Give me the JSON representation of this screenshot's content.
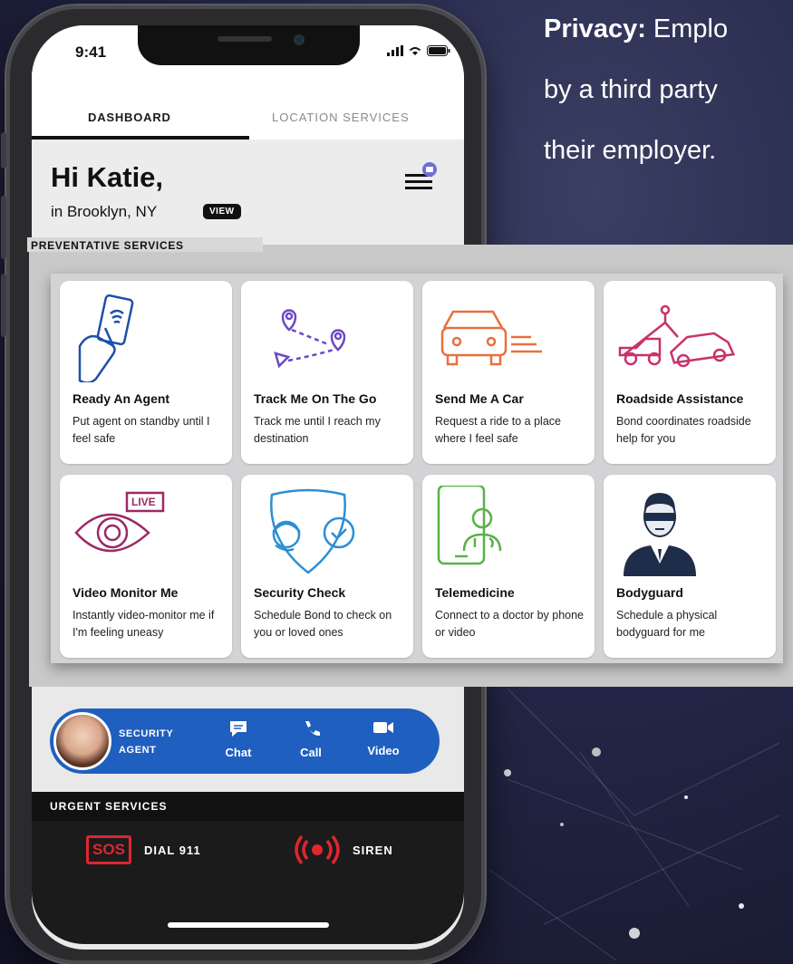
{
  "privacy": {
    "heading": "Privacy:",
    "line1_rest": " Emplo",
    "line2": "by a third party",
    "line3": "their employer."
  },
  "status_bar": {
    "time": "9:41"
  },
  "tabs": [
    {
      "label": "DASHBOARD",
      "active": true
    },
    {
      "label": "LOCATION SERVICES",
      "active": false
    }
  ],
  "greeting": {
    "title": "Hi Katie,",
    "location": "in Brooklyn, NY",
    "view_label": "VIEW"
  },
  "preventative": {
    "section_label": "PREVENTATIVE SERVICES",
    "cards": [
      {
        "icon": "tap-phone-icon",
        "title": "Ready An Agent",
        "desc": "Put agent on standby until I feel safe",
        "color": "#1f4fa8"
      },
      {
        "icon": "route-pins-icon",
        "title": "Track Me On The Go",
        "desc": "Track me until I reach my destination",
        "color": "#6c48c8"
      },
      {
        "icon": "car-icon",
        "title": "Send Me A Car",
        "desc": "Request a ride to a place where I feel safe",
        "color": "#e8703e"
      },
      {
        "icon": "tow-truck-icon",
        "title": "Roadside Assistance",
        "desc": "Bond coordinates roadside help for you",
        "color": "#c8326a"
      },
      {
        "icon": "live-eye-icon",
        "title": "Video Monitor Me",
        "desc": "Instantly video-monitor me if I'm feeling uneasy",
        "color": "#9a2a66",
        "badge": "LIVE"
      },
      {
        "icon": "shield-agent-icon",
        "title": "Security Check",
        "desc": "Schedule Bond to check on you or loved ones",
        "color": "#2b8fd4"
      },
      {
        "icon": "phone-doctor-icon",
        "title": "Telemedicine",
        "desc": "Connect to a doctor by phone or video",
        "color": "#5bb04a"
      },
      {
        "icon": "bodyguard-icon",
        "title": "Bodyguard",
        "desc": "Schedule a physical bodyguard for me",
        "color": "#1e2d4a"
      }
    ]
  },
  "agent_bar": {
    "label_line1": "SECURITY",
    "label_line2": "AGENT",
    "actions": [
      {
        "icon": "chat-icon",
        "label": "Chat"
      },
      {
        "icon": "phone-icon",
        "label": "Call"
      },
      {
        "icon": "video-camera-icon",
        "label": "Video"
      }
    ]
  },
  "urgent": {
    "section_label": "URGENT SERVICES",
    "sos_text": "SOS",
    "dial_label": "DIAL 911",
    "siren_label": "SIREN"
  },
  "colors": {
    "agent_bar": "#1f5fbf",
    "sos_red": "#e0262e",
    "background": "#25284a"
  }
}
